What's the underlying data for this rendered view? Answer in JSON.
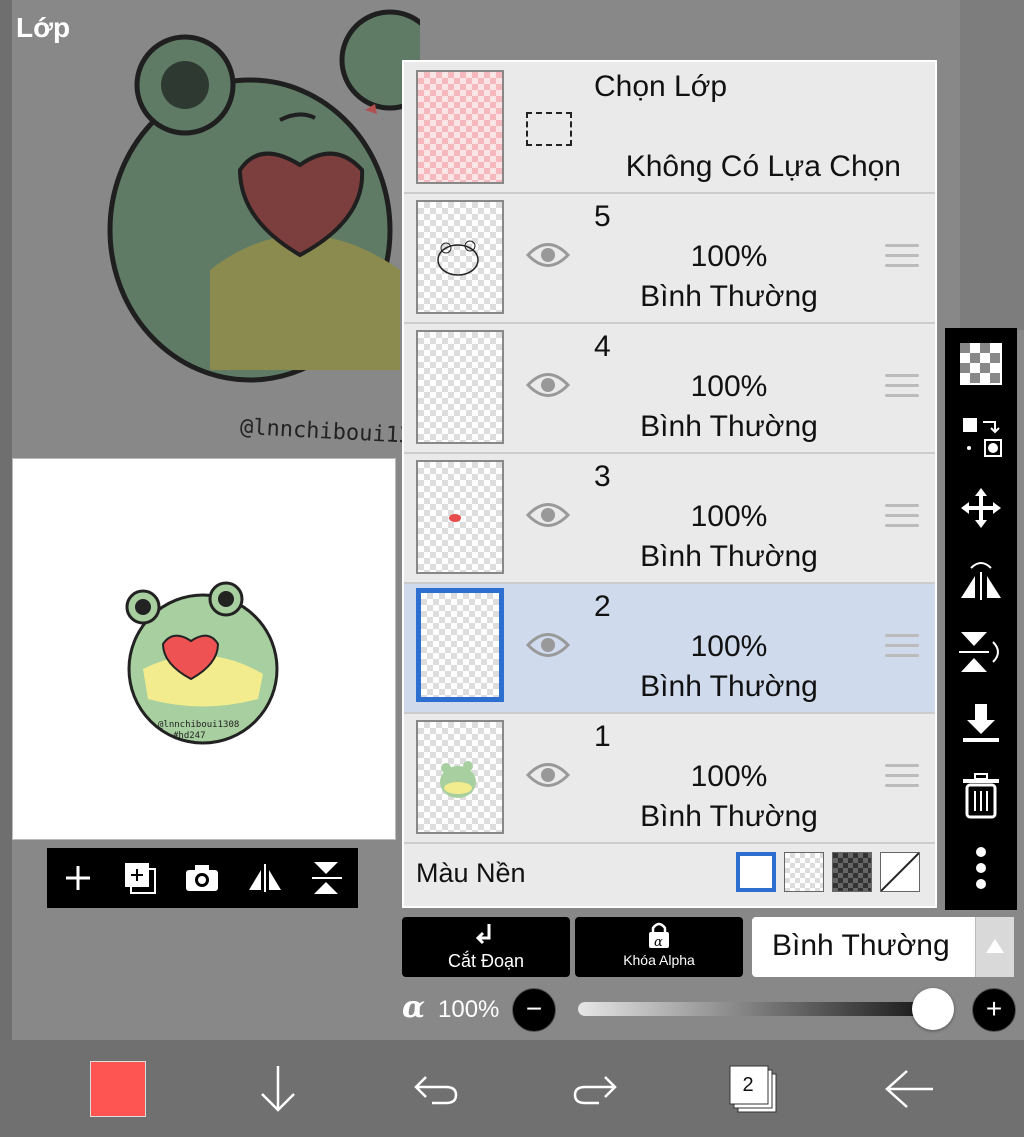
{
  "panel": {
    "title": "Lớp"
  },
  "artwork": {
    "signature": "@lnnchiboui1308"
  },
  "selection_layer": {
    "title": "Chọn Lớp",
    "subtitle": "Không Có Lựa Chọn"
  },
  "layers": [
    {
      "number": "5",
      "opacity": "100%",
      "blend_mode": "Bình Thường",
      "active": false
    },
    {
      "number": "4",
      "opacity": "100%",
      "blend_mode": "Bình Thường",
      "active": false
    },
    {
      "number": "3",
      "opacity": "100%",
      "blend_mode": "Bình Thường",
      "active": false
    },
    {
      "number": "2",
      "opacity": "100%",
      "blend_mode": "Bình Thường",
      "active": true
    },
    {
      "number": "1",
      "opacity": "100%",
      "blend_mode": "Bình Thường",
      "active": false
    }
  ],
  "background": {
    "label": "Màu Nền",
    "selected": "white"
  },
  "actions": {
    "clipping_label": "Cắt Đoạn",
    "alpha_lock_label": "Khóa Alpha"
  },
  "blend_select": {
    "value": "Bình Thường"
  },
  "opacity": {
    "symbol": "α",
    "value": "100%",
    "fraction": 1.0
  },
  "bottom_bar": {
    "color": "#ff5552",
    "layer_count": "2"
  },
  "colors": {
    "accent": "#2c6fd1",
    "active_row": "#cfdaec"
  }
}
